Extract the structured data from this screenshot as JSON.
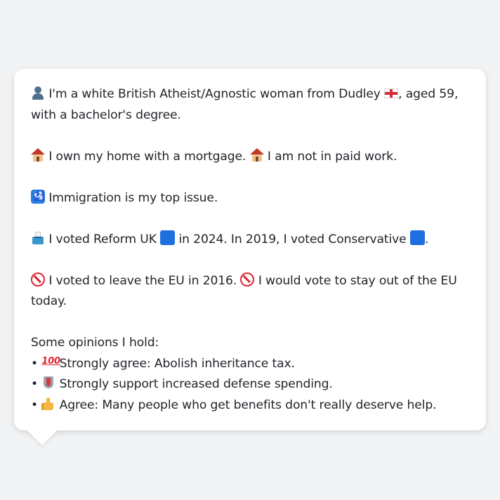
{
  "profile": {
    "intro_text_1": "I'm a white British Atheist/Agnostic woman from Dudley",
    "intro_text_2": ", aged 59,",
    "intro_text_3": "with a bachelor's degree.",
    "home_text_1": "I own my home with a mortgage.",
    "home_text_2": "I am not in paid work.",
    "issue_text": "Immigration is my top issue.",
    "vote_text_1": "I voted Reform UK",
    "vote_text_2": "in 2024. In 2019, I voted Conservative",
    "vote_text_3": ".",
    "eu_text_1": "I voted to leave the EU in 2016.",
    "eu_text_2": "I would vote to stay out of the EU",
    "eu_text_3": "today.",
    "opinions_heading": "Some opinions I hold:",
    "bullet": "•",
    "opinions": [
      "Strongly agree: Abolish inheritance tax.",
      "Strongly support increased defense spending.",
      "Agree: Many people who get benefits don't really deserve help."
    ],
    "icons": {
      "person": "person-silhouette-icon",
      "flag": "england-flag-icon",
      "home": "house-icon",
      "immigration": "passport-control-icon",
      "ballot": "ballot-box-icon",
      "party": "blue-square-icon",
      "prohibited": "prohibited-icon",
      "hundred": "hundred-points-icon",
      "shield": "shield-icon",
      "thumb": "thumbs-up-icon"
    },
    "hundred_glyph": "100",
    "immigration_glyph": "🛂"
  },
  "colors": {
    "background": "#f1f3f5",
    "bubble": "#ffffff",
    "text": "#1f2328",
    "party_blue": "#1e6fe0"
  }
}
